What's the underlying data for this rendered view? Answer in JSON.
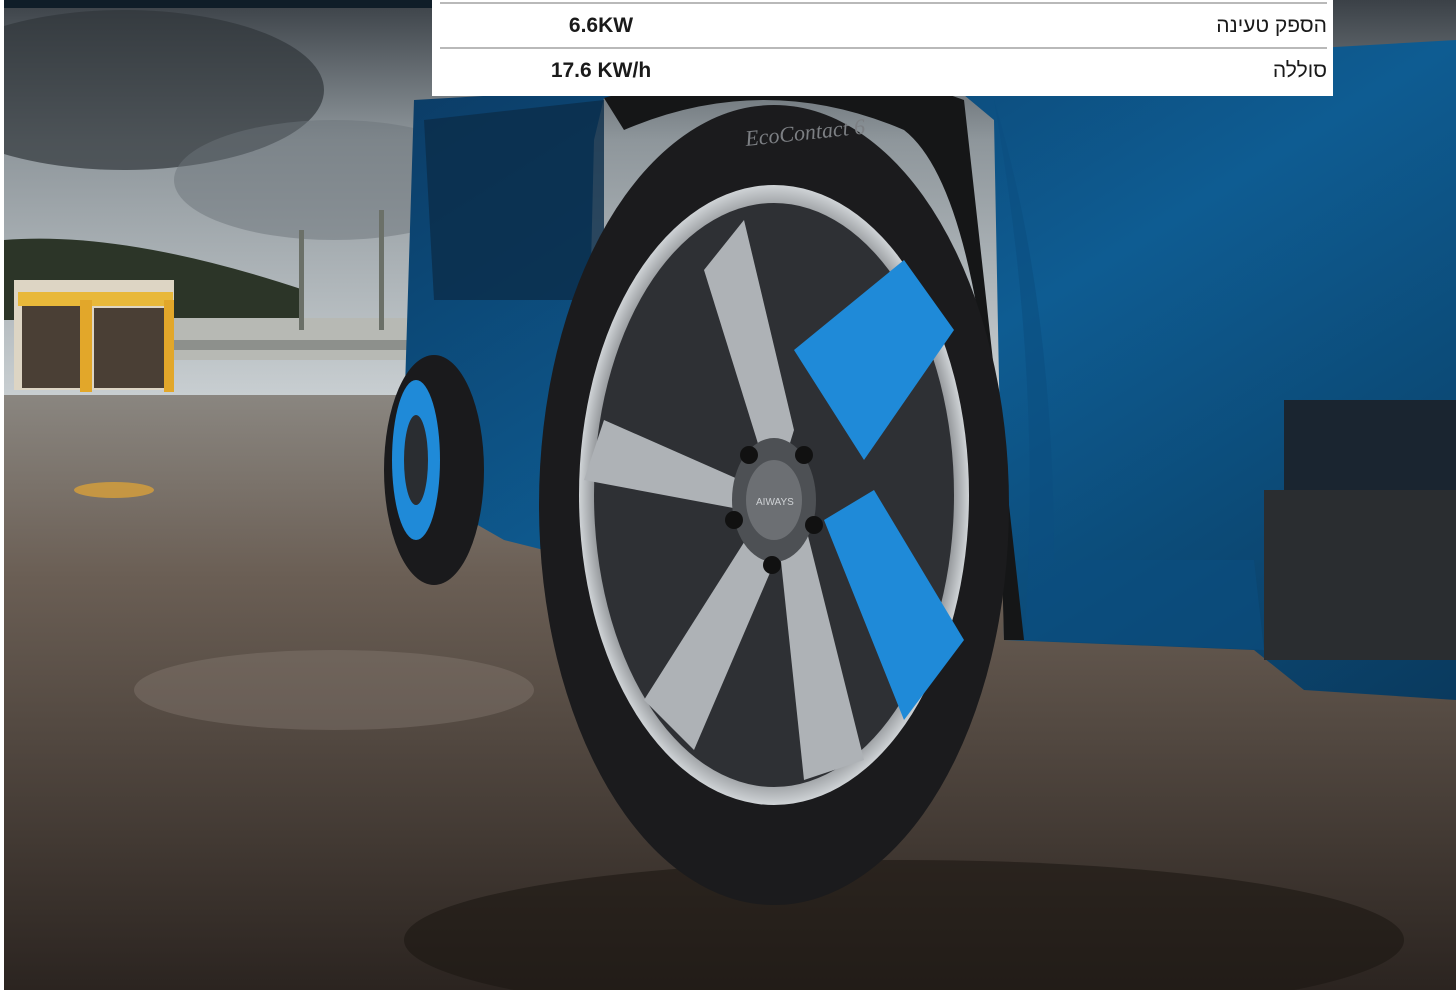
{
  "photo": {
    "subject": "car-wheel-photo",
    "accent_color": "#1f8ad8",
    "body_color": "#0e5c92",
    "tire_text": "EcoContact 6",
    "wheel_badge": "AIWAYS"
  },
  "specs": {
    "rows": [
      {
        "label": "הספק טעינה",
        "value": "6.6KW"
      },
      {
        "label": "סוללה",
        "value": "17.6 KW/h"
      }
    ]
  }
}
